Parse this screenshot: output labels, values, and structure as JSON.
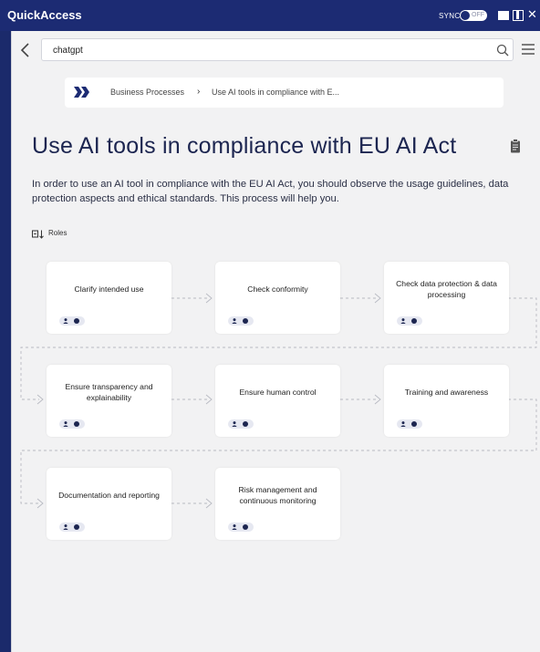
{
  "titlebar": {
    "app_title": "QuickAccess",
    "sync_label": "SYNC",
    "sync_state": "OFF"
  },
  "search": {
    "value": "chatgpt",
    "placeholder": ""
  },
  "breadcrumb": {
    "items": [
      "Business Processes",
      "Use AI tools in compliance with E..."
    ]
  },
  "page": {
    "title": "Use AI tools in compliance with EU AI Act",
    "intro": "In order to use an AI tool in compliance with the EU AI Act, you should observe the usage guidelines, data protection aspects and ethical standards. This process will help you.",
    "roles_label": "Roles"
  },
  "steps": [
    {
      "label": "Clarify intended use"
    },
    {
      "label": "Check conformity"
    },
    {
      "label": "Check data protection & data processing"
    },
    {
      "label": "Ensure transparency and explainability"
    },
    {
      "label": "Ensure human control"
    },
    {
      "label": "Training and awareness"
    },
    {
      "label": "Documentation and reporting"
    },
    {
      "label": "Risk management and continuous monitoring"
    }
  ],
  "colors": {
    "titlebar": "#1c2b73",
    "accent": "#1c2550",
    "background": "#f2f2f3"
  }
}
